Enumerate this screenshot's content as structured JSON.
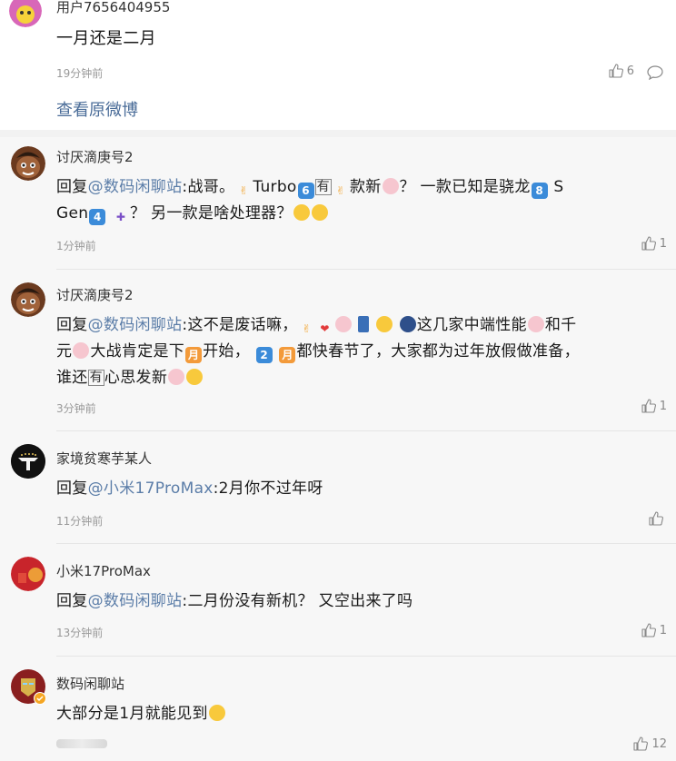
{
  "top_comment": {
    "username": "用户7656404955",
    "text": "一月还是二月",
    "time": "19分钟前",
    "like_count": "6",
    "view_original": "查看原微博"
  },
  "replies": [
    {
      "username": "讨厌滴庚号2",
      "prefix": "回复",
      "mention": "@数码闲聊站",
      "text_a": ":战哥。",
      "text_b": "Turbo",
      "text_c": "款新",
      "text_d": "？ 一款已知是骁龙",
      "text_e": "S",
      "text_f": "Gen",
      "text_g": "？ 另一款是啥处理器？",
      "time": "1分钟前",
      "like_count": "1"
    },
    {
      "username": "讨厌滴庚号2",
      "prefix": "回复",
      "mention": "@数码闲聊站",
      "text_a": ":这不是废话嘛，",
      "text_b": "这几家中端性能",
      "text_c": "和千",
      "text_d": "元",
      "text_e": "大战肯定是下",
      "text_f": "开始，",
      "text_g": "都快春节了，大家都为过年放假做准备，",
      "text_h": "谁还",
      "text_i": "心思发新",
      "time": "3分钟前",
      "like_count": "1"
    },
    {
      "username": "家境贫寒芋某人",
      "prefix": "回复",
      "mention": "@小米17ProMax",
      "text": ":2月你不过年呀",
      "time": "11分钟前",
      "like_count": ""
    },
    {
      "username": "小米17ProMax",
      "prefix": "回复",
      "mention": "@数码闲聊站",
      "text": ":二月份没有新机？ 又空出来了吗",
      "time": "13分钟前",
      "like_count": "1"
    },
    {
      "username": "数码闲聊站",
      "text": "大部分是1月就能见到",
      "like_count": "12"
    }
  ],
  "emoji_labels": {
    "six": "6",
    "eight": "8",
    "four": "4",
    "two": "2",
    "you": "有",
    "month": "月",
    "plus": "✚"
  },
  "colors": {
    "mention": "#5b7da8",
    "link": "#4a6c98",
    "reply_bg": "#f7f7f7",
    "time": "#999999"
  }
}
